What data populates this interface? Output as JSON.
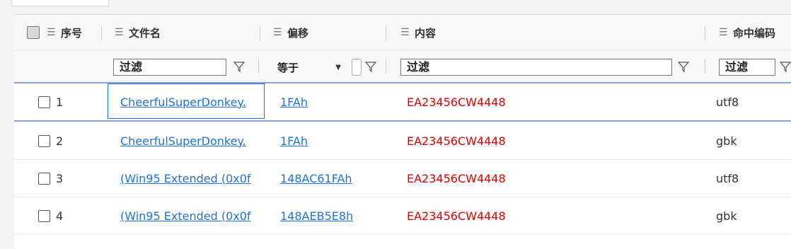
{
  "header": {
    "seq": "序号",
    "filename": "文件名",
    "offset": "偏移",
    "content": "内容",
    "encoding": "命中编码"
  },
  "filters": {
    "filename_placeholder": "过滤",
    "offset_operator": "等于",
    "content_placeholder": "过滤",
    "encoding_placeholder": "过滤"
  },
  "rows": [
    {
      "seq": "1",
      "filename": "CheerfulSuperDonkey.",
      "offset": "1FAh",
      "content": "EA23456CW4448",
      "encoding": "utf8"
    },
    {
      "seq": "2",
      "filename": "CheerfulSuperDonkey.",
      "offset": "1FAh",
      "content": "EA23456CW4448",
      "encoding": "gbk"
    },
    {
      "seq": "3",
      "filename": "(Win95 Extended (0x0f",
      "offset": "148AC61FAh",
      "content": "EA23456CW4448",
      "encoding": "utf8"
    },
    {
      "seq": "4",
      "filename": "(Win95 Extended (0x0f",
      "offset": "148AEB5E8h",
      "content": "EA23456CW4448",
      "encoding": "gbk"
    }
  ],
  "icons": {
    "menu": "hamburger-icon",
    "filter": "funnel-icon",
    "dropdown": "caret-down-icon"
  },
  "colors": {
    "link": "#1e73d8",
    "content_text": "#e00000",
    "selected_row_border": "#8d9fd9"
  }
}
